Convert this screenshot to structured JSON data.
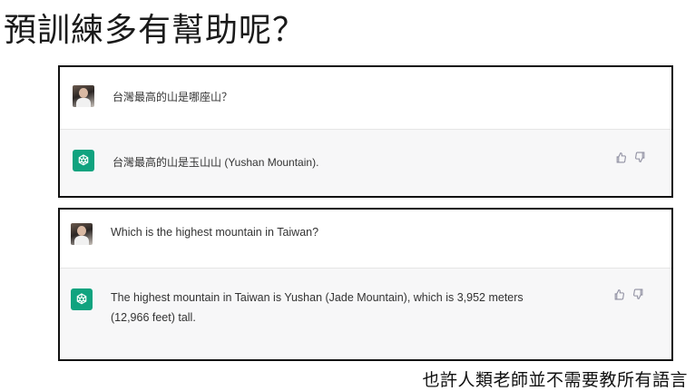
{
  "title": "預訓練多有幫助呢？",
  "chat_1": {
    "user_message": "台灣最高的山是哪座山？",
    "assistant_message": "台灣最高的山是玉山山 (Yushan Mountain)."
  },
  "chat_2": {
    "user_message": "Which is the highest mountain in Taiwan?",
    "assistant_message_line1": "The highest mountain in Taiwan is Yushan (Jade Mountain), which is 3,952 meters",
    "assistant_message_line2": "(12,966 feet) tall."
  },
  "caption": "也許人類老師並不需要教所有語言",
  "colors": {
    "brand_green": "#10a37f",
    "bot_row_bg": "#f7f7f8",
    "icon_gray": "#8e8ea0"
  },
  "icons": [
    "user-avatar",
    "chatgpt-logo-icon",
    "thumbs-up-icon",
    "thumbs-down-icon"
  ]
}
